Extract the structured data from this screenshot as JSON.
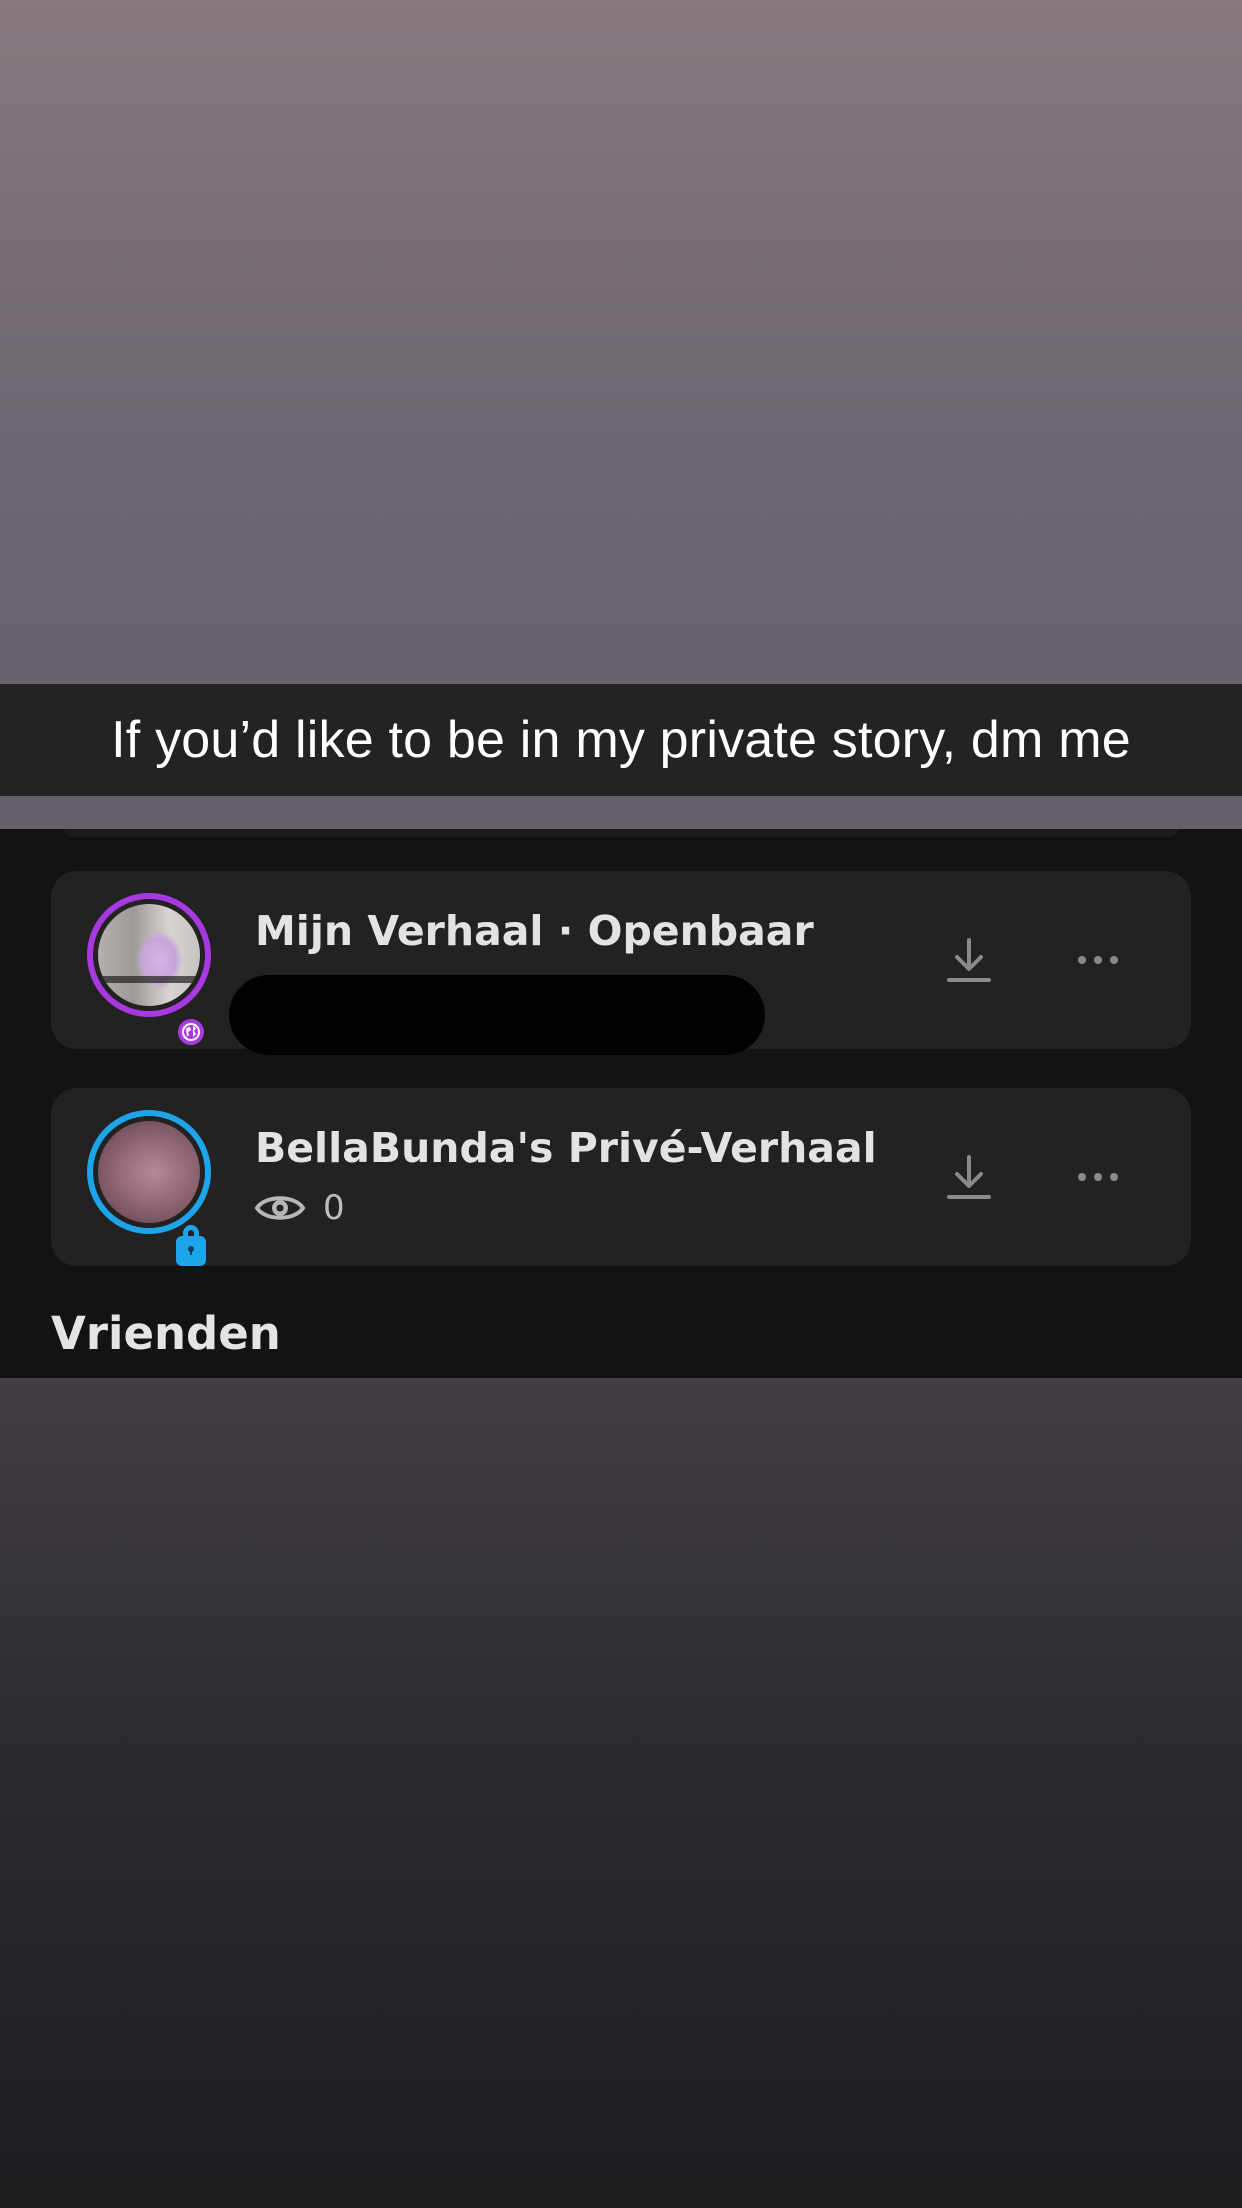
{
  "story_caption": "If you’d like to be in my private story, dm me",
  "stories": [
    {
      "title": "Mijn Verhaal · Openbaar",
      "avatar_ring_color": "#a63ae0",
      "badge_icon": "globe-icon",
      "subtitle_redacted": true
    },
    {
      "title": "BellaBunda's Privé-Verhaal",
      "avatar_ring_color": "#1ea4e8",
      "badge_icon": "lock-icon",
      "views": "0"
    }
  ],
  "sections": {
    "friends_heading": "Vrienden"
  },
  "icons": {
    "download": "download-icon",
    "more": "more-options-icon",
    "views": "eye-icon"
  }
}
